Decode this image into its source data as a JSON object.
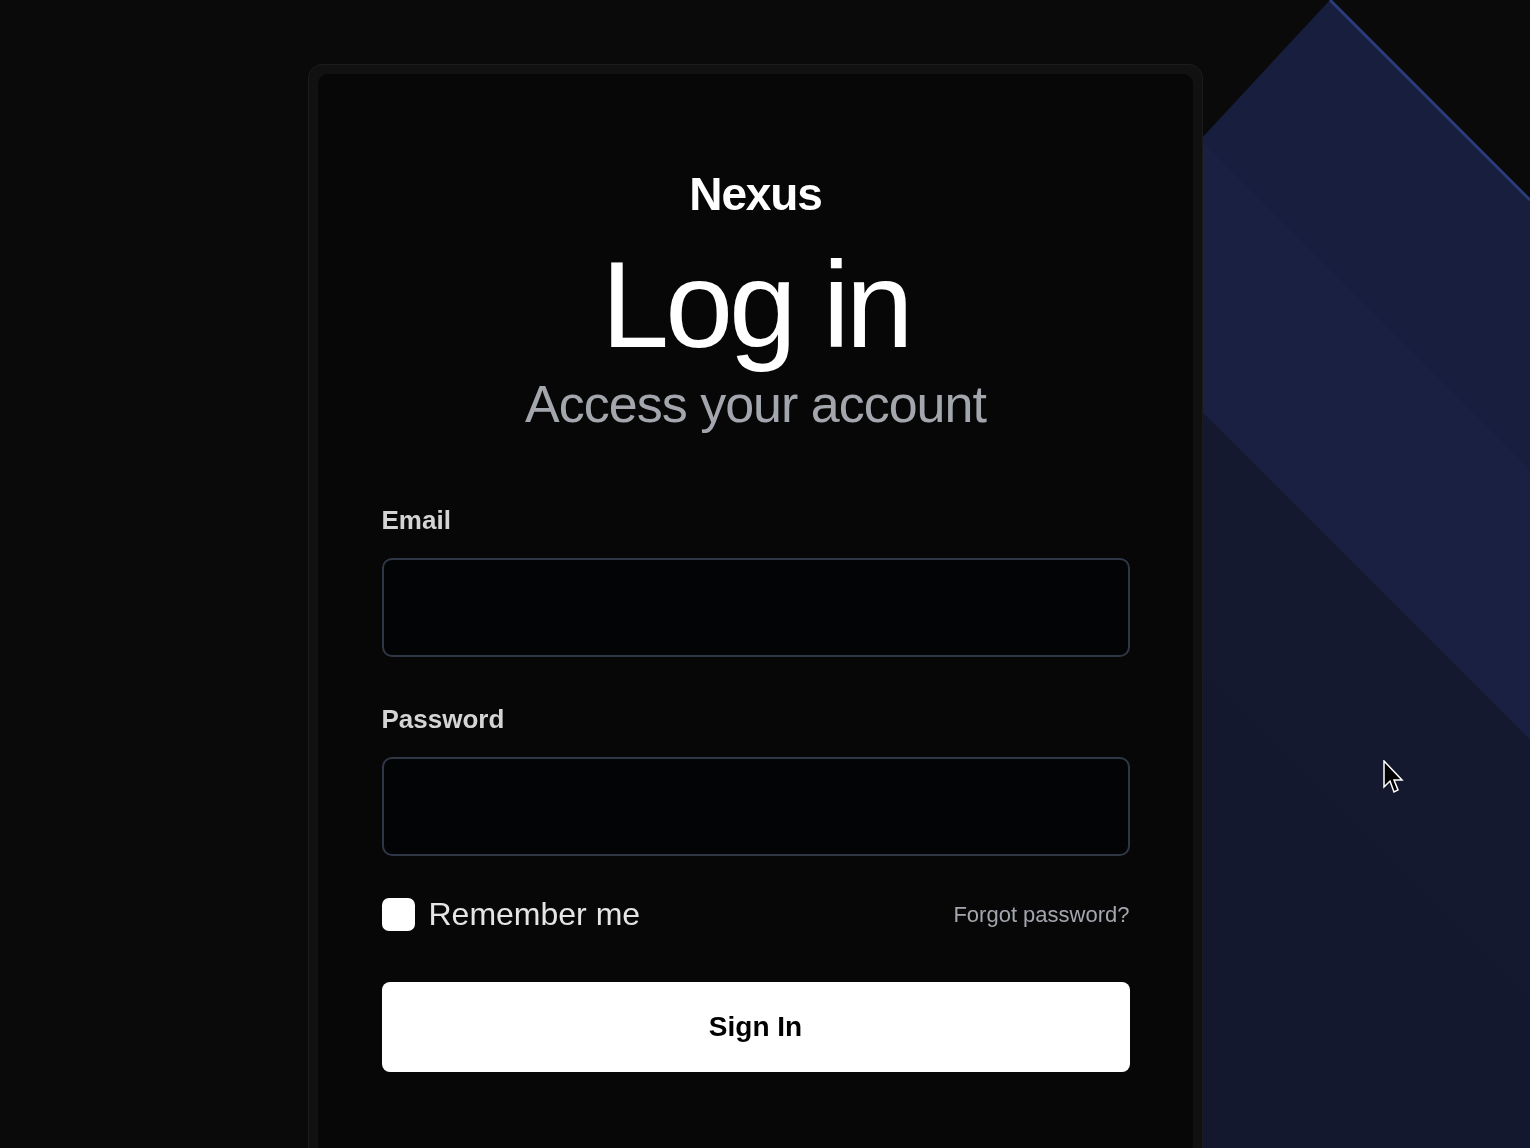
{
  "brand": "Nexus",
  "title": "Log in",
  "subtitle": "Access your account",
  "fields": [
    {
      "label": "Email"
    },
    {
      "label": "Password"
    }
  ],
  "remember": {
    "label": "Remember me",
    "checked": false
  },
  "forgot_link": "Forgot password?",
  "submit": "Sign In"
}
